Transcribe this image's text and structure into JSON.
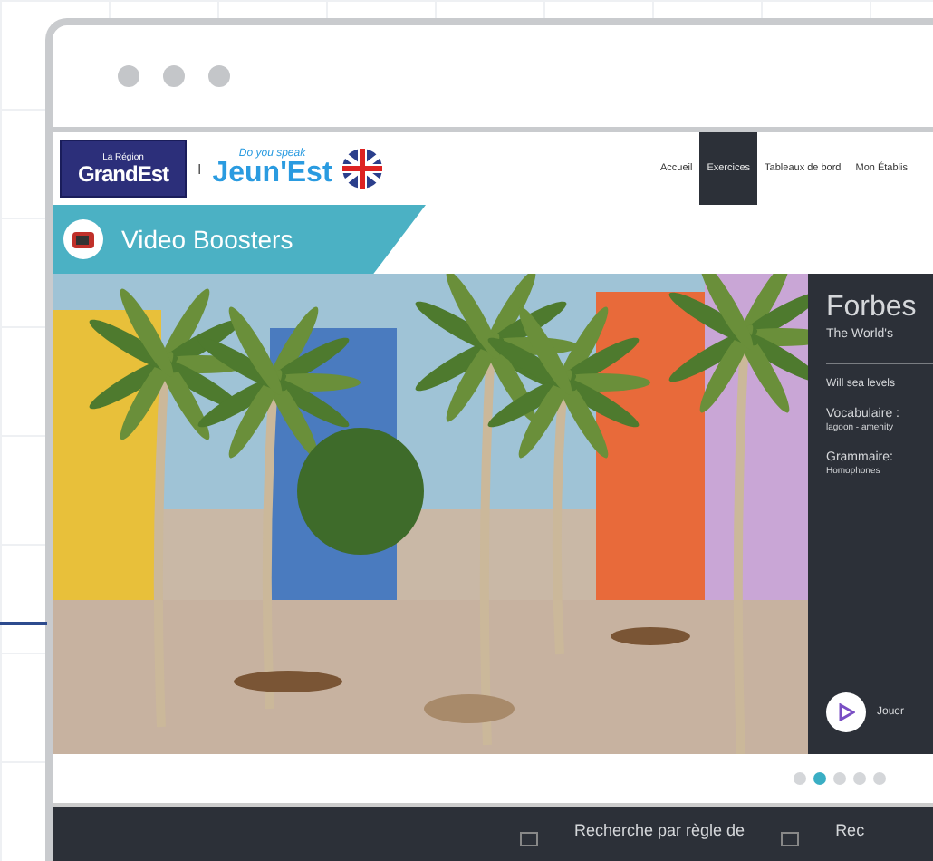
{
  "header": {
    "region_logo": {
      "small": "La Région",
      "big": "GrandEst"
    },
    "separator": "I",
    "brand": {
      "small": "Do you speak",
      "big": "Jeun'Est"
    },
    "nav": [
      {
        "label": "Accueil",
        "selected": false
      },
      {
        "label": "Exercices",
        "selected": true
      },
      {
        "label": "Tableaux de bord",
        "selected": false
      },
      {
        "label": "Mon Établis",
        "selected": false
      }
    ]
  },
  "banner": {
    "title": "Video Boosters"
  },
  "hero": {
    "panel": {
      "title": "Forbes",
      "subtitle": "The World's",
      "question": "Will sea levels",
      "vocab": [
        "Vocabulaire :",
        "lagoon - amenity"
      ],
      "grammar": [
        "Grammaire:",
        "Homophones"
      ],
      "play": "Jouer"
    },
    "pager": [
      {
        "selected": false
      },
      {
        "selected": true
      },
      {
        "selected": false
      },
      {
        "selected": false
      },
      {
        "selected": false
      }
    ]
  },
  "footer": {
    "items": [
      "Recherche par règle de",
      "Rec"
    ]
  }
}
